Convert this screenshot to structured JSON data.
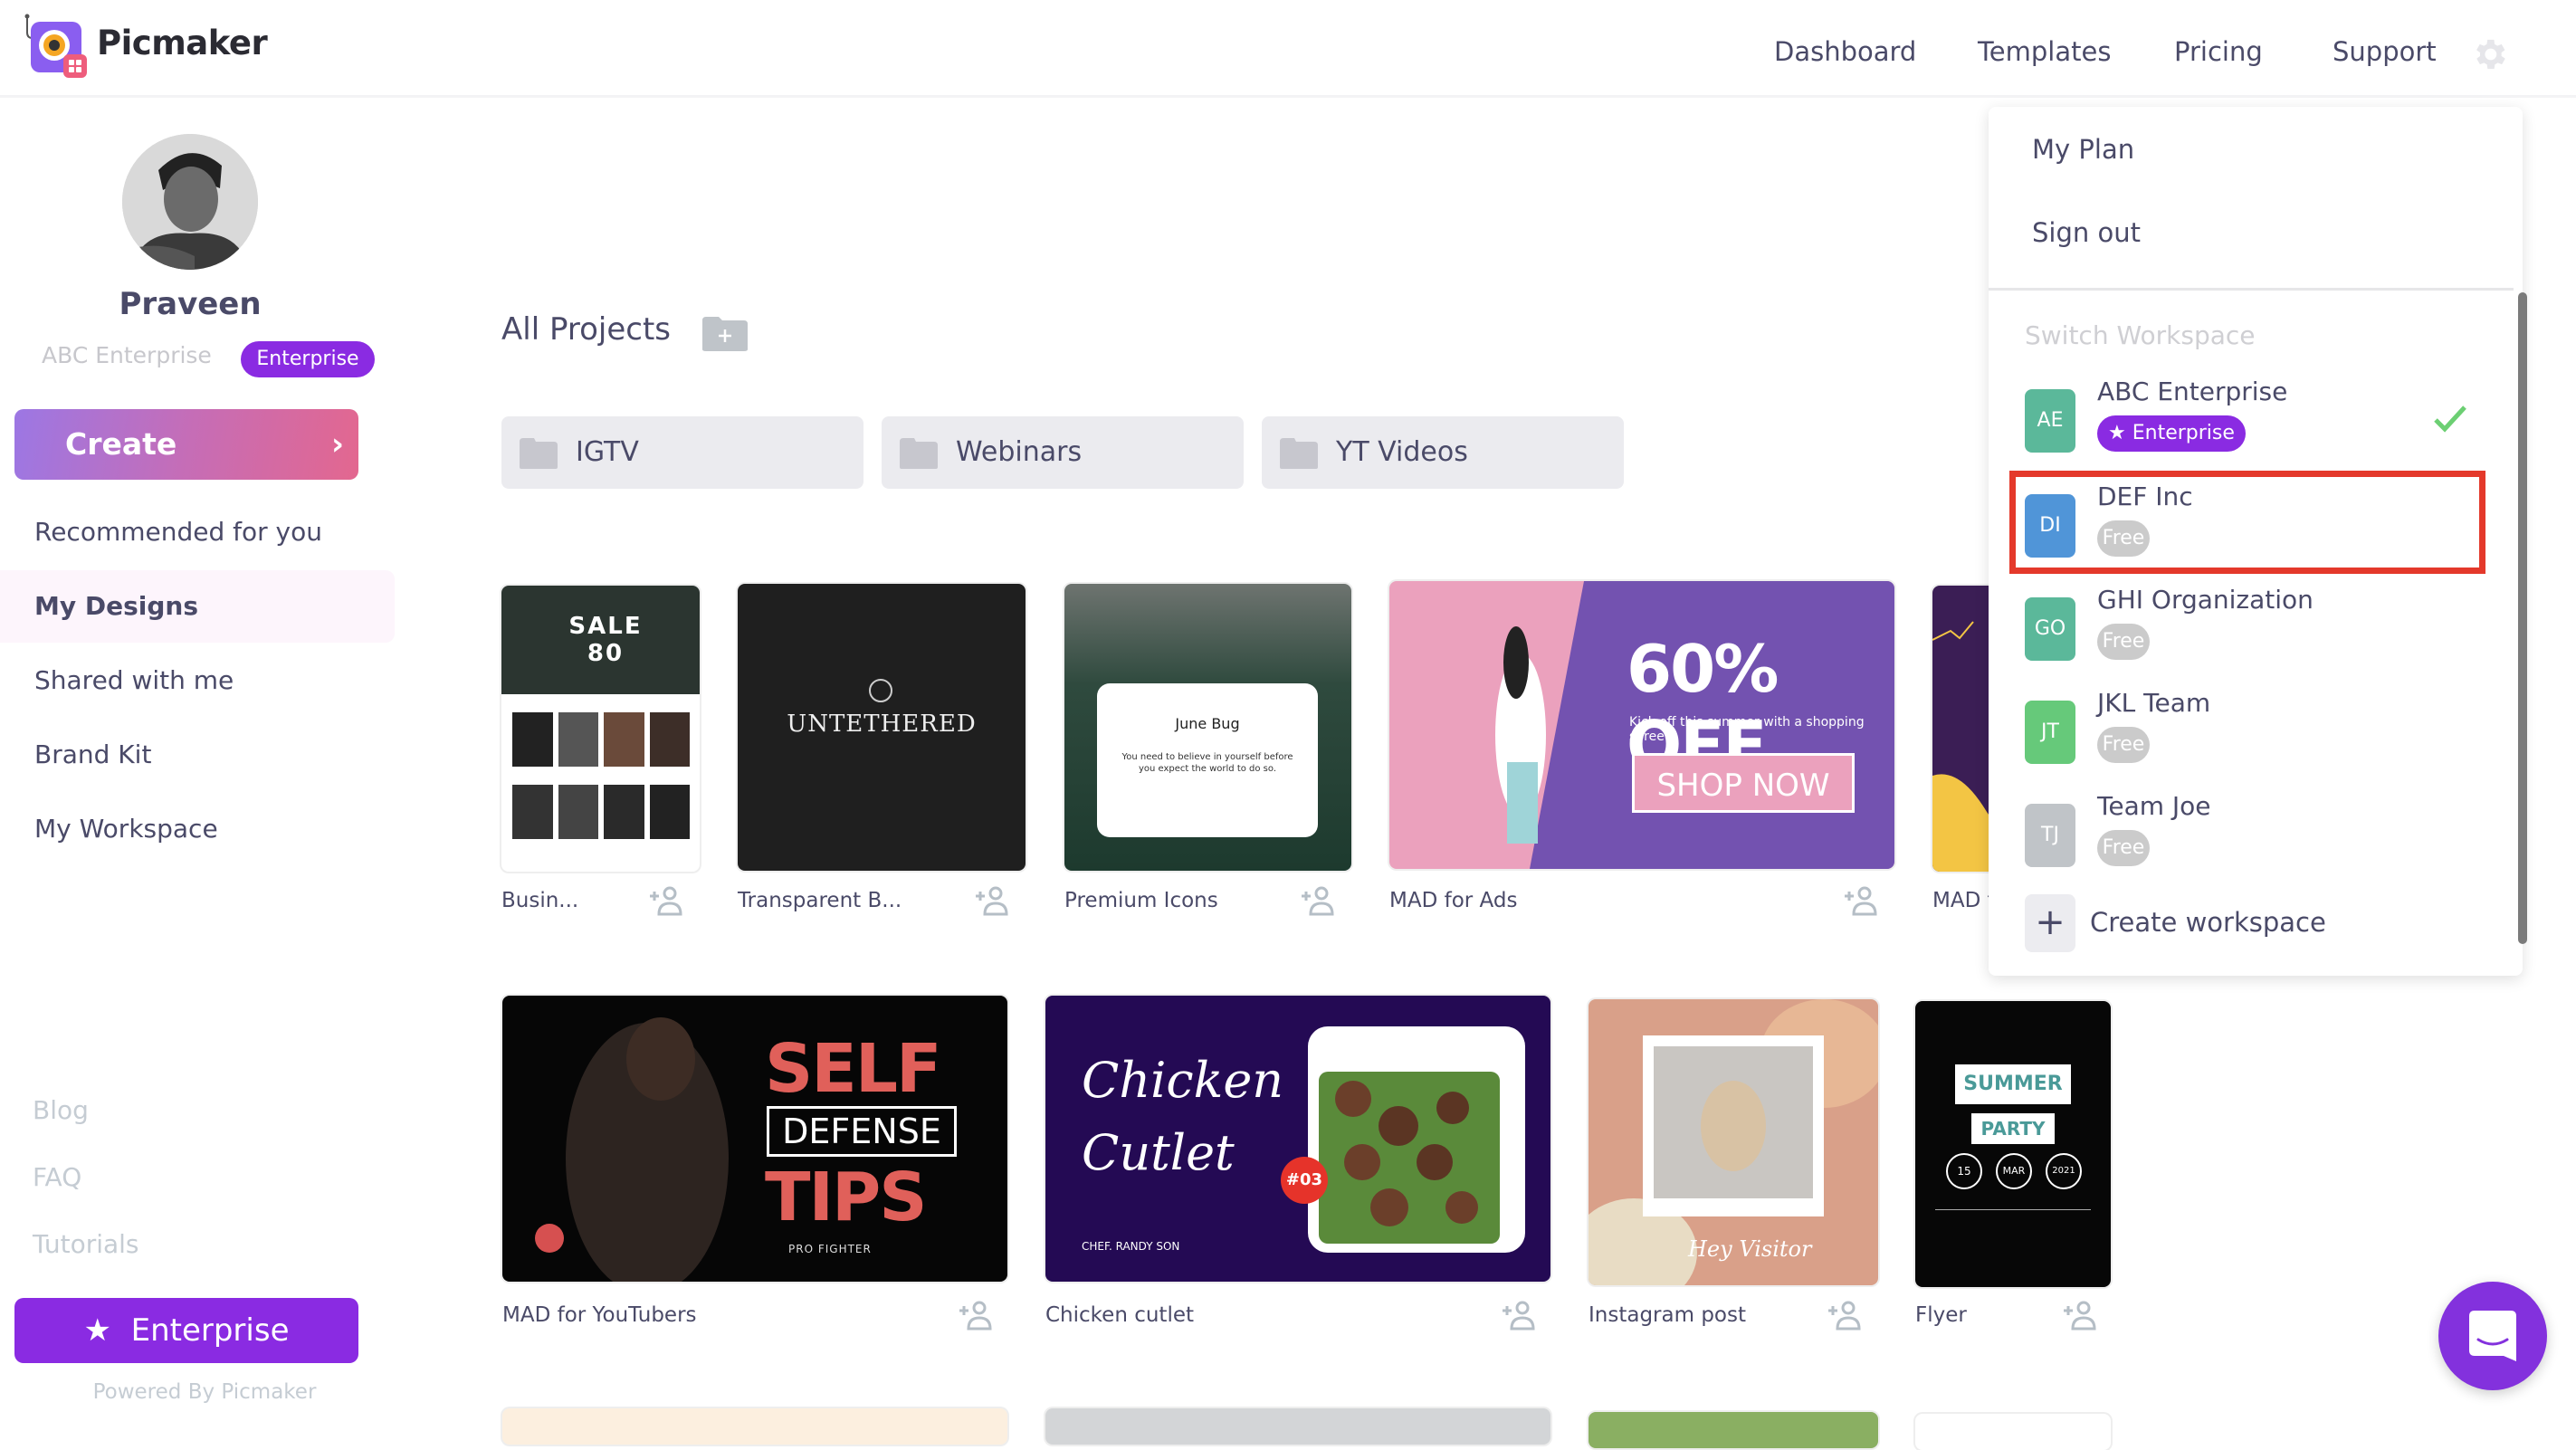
{
  "app": {
    "name": "Picmaker"
  },
  "nav": {
    "items": [
      "Dashboard",
      "Templates",
      "Pricing",
      "Support"
    ],
    "settings_icon": "gear-icon"
  },
  "sidebar": {
    "user": {
      "name": "Praveen",
      "workspace": "ABC Enterprise",
      "plan": "Enterprise"
    },
    "create_label": "Create",
    "items": [
      {
        "label": "Recommended for you",
        "active": false
      },
      {
        "label": "My Designs",
        "active": true
      },
      {
        "label": "Shared with me",
        "active": false
      },
      {
        "label": "Brand Kit",
        "active": false
      },
      {
        "label": "My Workspace",
        "active": false
      }
    ],
    "footer_links": [
      "Blog",
      "FAQ",
      "Tutorials"
    ],
    "enterprise_label": "Enterprise",
    "powered_by": "Powered By Picmaker"
  },
  "main": {
    "title": "All Projects",
    "folders": [
      "IGTV",
      "Webinars",
      "YT Videos"
    ],
    "designs_row1": [
      {
        "label": "Busin...",
        "thumb_text": "SALE 80"
      },
      {
        "label": "Transparent B...",
        "thumb_text": "UNTETHERED"
      },
      {
        "label": "Premium Icons",
        "thumb_text": "June Bug",
        "thumb_subtext": "You need to believe in yourself before you expect the world to do so."
      },
      {
        "label": "MAD for Ads",
        "thumb_text": "60% OFF",
        "thumb_subtext": "Kick off this summer with a shopping spree",
        "thumb_button": "SHOP NOW"
      },
      {
        "label": "MAD f"
      }
    ],
    "designs_row2": [
      {
        "label": "MAD for YouTubers",
        "thumb_text": [
          "SELF",
          "DEFENSE",
          "TIPS"
        ],
        "thumb_subtext": "PRO FIGHTER"
      },
      {
        "label": "Chicken cutlet",
        "thumb_text": [
          "Chicken",
          "Cutlet"
        ],
        "thumb_badge": "#03",
        "thumb_subtext": "CHEF. RANDY SON"
      },
      {
        "label": "Instagram post",
        "thumb_text": "Hey Visitor"
      },
      {
        "label": "Flyer",
        "thumb_text": [
          "SUMMER",
          "PARTY"
        ],
        "thumb_date": [
          "15",
          "MAR",
          "2021"
        ]
      }
    ]
  },
  "dropdown": {
    "items": [
      "My Plan",
      "Sign out"
    ],
    "switch_title": "Switch Workspace",
    "workspaces": [
      {
        "initials": "AE",
        "name": "ABC Enterprise",
        "plan": "Enterprise",
        "color": "#5bb89a",
        "selected": true
      },
      {
        "initials": "DI",
        "name": "DEF Inc",
        "plan": "Free",
        "color": "#5095d8",
        "selected": false,
        "highlighted": true
      },
      {
        "initials": "GO",
        "name": "GHI Organization",
        "plan": "Free",
        "color": "#5bb89a",
        "selected": false
      },
      {
        "initials": "JT",
        "name": "JKL Team",
        "plan": "Free",
        "color": "#66c97a",
        "selected": false
      },
      {
        "initials": "TJ",
        "name": "Team Joe",
        "plan": "Free",
        "color": "#c0c4c8",
        "selected": false
      }
    ],
    "create_label": "Create workspace"
  },
  "colors": {
    "brand_purple": "#8a2be2",
    "highlight_red": "#e4392b",
    "check_green": "#6ccf73"
  }
}
